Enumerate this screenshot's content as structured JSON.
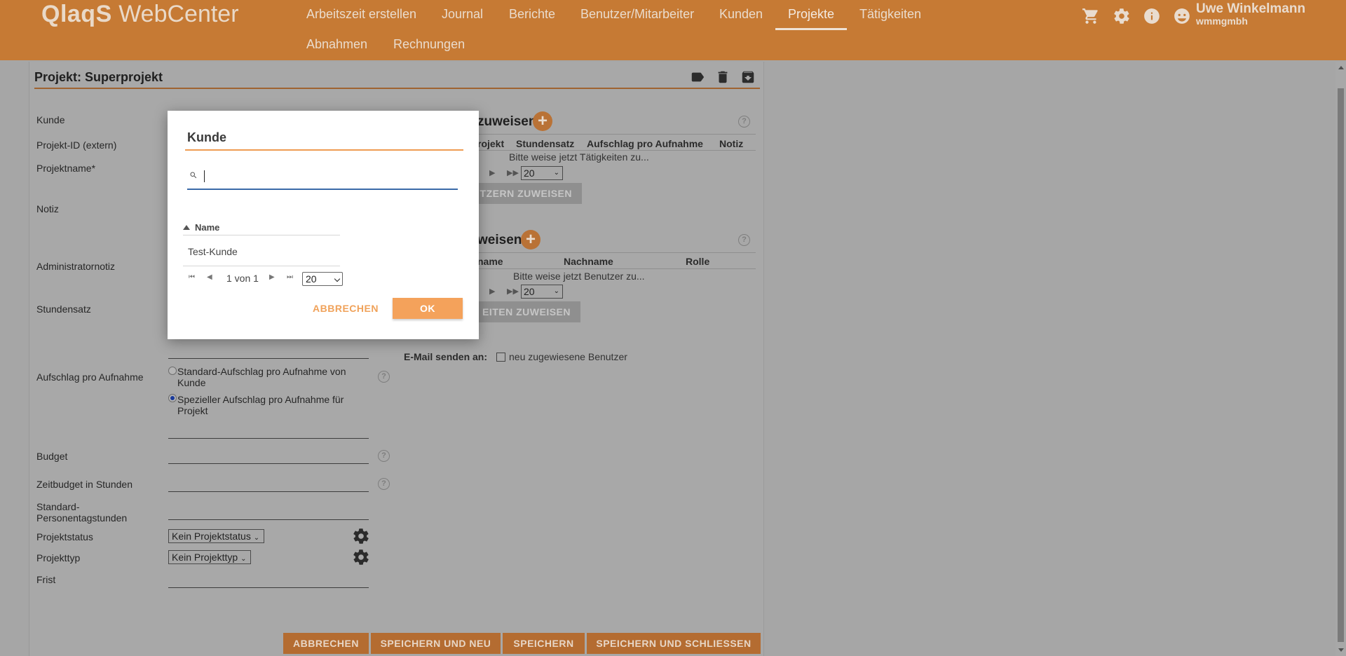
{
  "app": {
    "logo_bold": "QlaqS",
    "logo_rest": " WebCenter"
  },
  "nav": {
    "items": [
      {
        "label": "Arbeitszeit erstellen"
      },
      {
        "label": "Journal"
      },
      {
        "label": "Berichte"
      },
      {
        "label": "Benutzer/Mitarbeiter"
      },
      {
        "label": "Kunden"
      },
      {
        "label": "Projekte"
      },
      {
        "label": "Tätigkeiten"
      },
      {
        "label": "Abnahmen"
      },
      {
        "label": "Rechnungen"
      }
    ],
    "active": "Projekte"
  },
  "user": {
    "name": "Uwe Winkelmann",
    "company": "wmmgmbh"
  },
  "project": {
    "title": "Projekt: Superprojekt",
    "labels": {
      "kunde": "Kunde",
      "projekt_id": "Projekt-ID (extern)",
      "projektname": "Projektname*",
      "notiz": "Notiz",
      "admin_notiz": "Administratornotiz",
      "stundensatz": "Stundensatz",
      "aufschlag": "Aufschlag pro Aufnahme",
      "budget": "Budget",
      "zeitbudget": "Zeitbudget in Stunden",
      "personentage_1": "Standard-",
      "personentage_2": "Personentagstunden",
      "projektstatus": "Projektstatus",
      "projekttyp": "Projekttyp",
      "frist": "Frist"
    },
    "aufschlag_options": {
      "standard": "Standard-Aufschlag pro Aufnahme von Kunde",
      "special": "Spezieller Aufschlag pro Aufnahme für Projekt",
      "selected": "special"
    },
    "projektstatus_value": "Kein Projektstatus",
    "projekttyp_value": "Kein Projekttyp"
  },
  "activities_section": {
    "title": "zuweisen",
    "headers": [
      "rojekt",
      "Stundensatz",
      "Aufschlag pro Aufnahme",
      "Notiz"
    ],
    "empty": "Bitte weise jetzt Tätigkeiten zu...",
    "page_size": "20",
    "assign_button": "TZERN ZUWEISEN"
  },
  "users_section": {
    "title": "weisen",
    "headers": [
      "name",
      "Nachname",
      "Rolle"
    ],
    "empty": "Bitte weise jetzt Benutzer zu...",
    "page_size": "20",
    "assign_button": "EITEN ZUWEISEN"
  },
  "email": {
    "label": "E-Mail senden an:",
    "option": "neu zugewiesene Benutzer"
  },
  "footer_buttons": {
    "cancel": "ABBRECHEN",
    "save_new": "SPEICHERN UND NEU",
    "save": "SPEICHERN",
    "save_close": "SPEICHERN UND SCHLIESSEN"
  },
  "modal": {
    "title": "Kunde",
    "search_value": "",
    "column": "Name",
    "rows": [
      "Test-Kunde"
    ],
    "pagination": "1 von 1",
    "page_size": "20",
    "cancel": "ABBRECHEN",
    "ok": "OK"
  },
  "colors": {
    "brand": "#c67a34",
    "modal_accent": "#f4a25b"
  }
}
